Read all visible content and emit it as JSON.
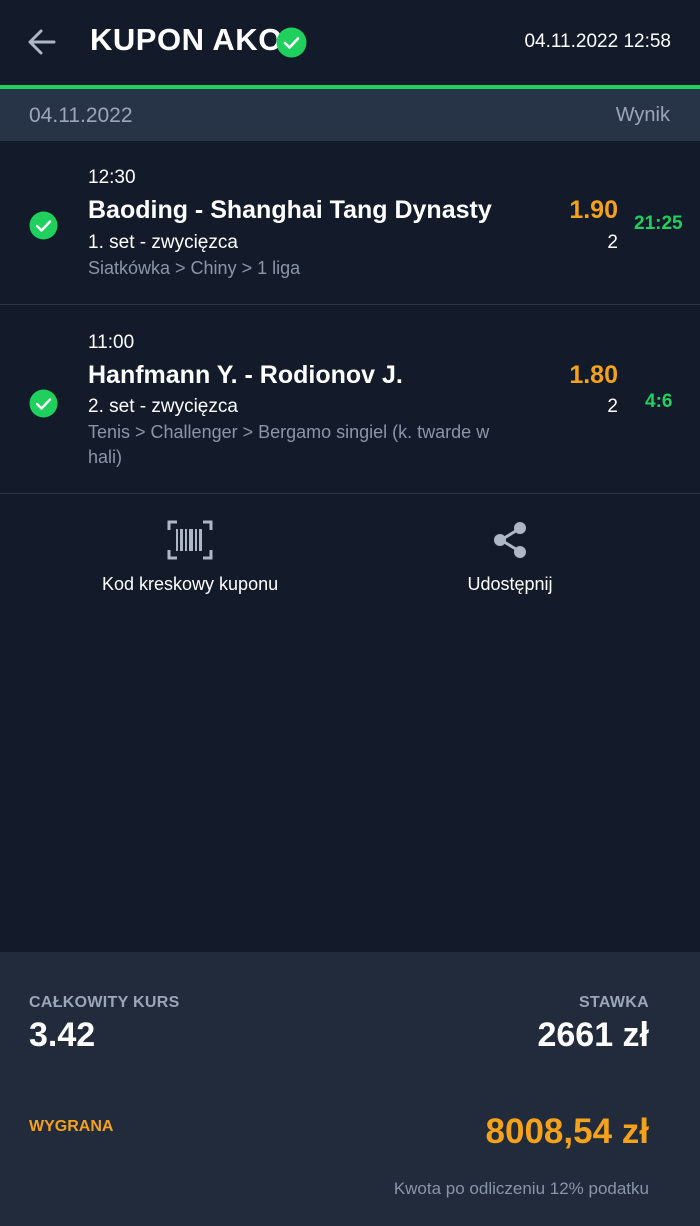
{
  "header": {
    "title": "KUPON AKO",
    "datetime": "04.11.2022 12:58"
  },
  "date_bar": {
    "date": "04.11.2022",
    "result_label": "Wynik"
  },
  "matches": [
    {
      "time": "12:30",
      "teams": "Baoding - Shanghai Tang Dynasty",
      "market": "1. set - zwycięzca",
      "league": "Siatkówka > Chiny > 1 liga",
      "odds": "1.90",
      "pick": "2",
      "score": "21:25"
    },
    {
      "time": "11:00",
      "teams": "Hanfmann Y. - Rodionov J.",
      "market": "2. set - zwycięzca",
      "league": "Tenis > Challenger > Bergamo singiel (k. twarde w hali)",
      "odds": "1.80",
      "pick": "2",
      "score": "4:6"
    }
  ],
  "actions": {
    "barcode_label": "Kod kreskowy kuponu",
    "share_label": "Udostępnij"
  },
  "summary": {
    "total_odds_label": "CAŁKOWITY KURS",
    "total_odds": "3.42",
    "stake_label": "STAWKA",
    "stake": "2661 zł",
    "win_label": "WYGRANA",
    "win": "8008,54 zł",
    "tax_note": "Kwota po odliczeniu 12% podatku"
  },
  "colors": {
    "background": "#131b2b",
    "accent_green": "#1fd15c",
    "odds_orange": "#f5a21b",
    "muted": "#9ba6b8"
  },
  "icons": [
    "back-arrow-icon",
    "check-circle-icon",
    "barcode-icon",
    "share-icon"
  ]
}
